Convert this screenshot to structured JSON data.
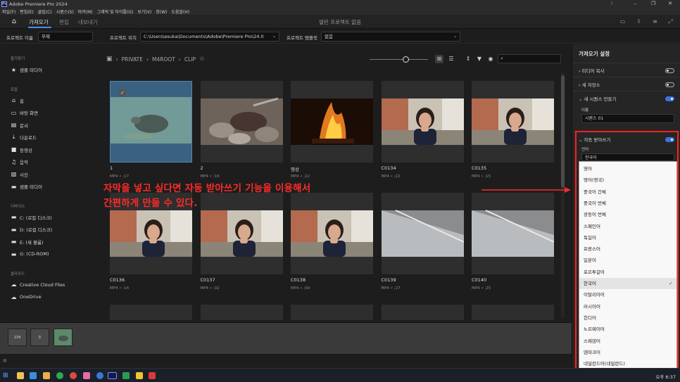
{
  "window": {
    "title": "Adobe Premiere Pro 2024",
    "app_icon_label": "Pr",
    "menus": [
      "파일(F)",
      "편집(E)",
      "클립(C)",
      "시퀀스(S)",
      "마커(M)",
      "그래픽 및 타이틀(G)",
      "보기(V)",
      "창(W)",
      "도움말(H)"
    ]
  },
  "header": {
    "tabs": [
      "가져오기",
      "편집",
      "내보내기"
    ],
    "active_tab": 0,
    "project_title": "열린 프로젝트 없음"
  },
  "project_row": {
    "name_label": "프로젝트 이름",
    "name_value": "무제",
    "location_label": "프로젝트 위치",
    "location_value": "C:\\Users\\esuka\\Documents\\Adobe\\Premiere Pro\\24.0",
    "template_label": "프로젝트 템플릿",
    "template_value": "없음"
  },
  "sidebar": {
    "sections": [
      {
        "heading": "즐겨찾기",
        "items": [
          {
            "label": "샘플 미디어",
            "icon": "star-icon"
          }
        ]
      },
      {
        "heading": "로컬",
        "items": [
          {
            "label": "홈",
            "icon": "home-icon"
          },
          {
            "label": "바탕 화면",
            "icon": "monitor-icon"
          },
          {
            "label": "문서",
            "icon": "document-icon"
          },
          {
            "label": "다운로드",
            "icon": "download-icon"
          },
          {
            "label": "동영상",
            "icon": "video-icon"
          },
          {
            "label": "음악",
            "icon": "music-icon"
          },
          {
            "label": "사진",
            "icon": "image-icon"
          },
          {
            "label": "샘플 미디어",
            "icon": "folder-icon"
          }
        ]
      },
      {
        "heading": "디바이스",
        "items": [
          {
            "label": "C: (로컬 디스크)",
            "icon": "folder-icon"
          },
          {
            "label": "D: (로컬 디스크)",
            "icon": "folder-icon"
          },
          {
            "label": "E: (새 볼륨)",
            "icon": "folder-icon"
          },
          {
            "label": "G: (CD-ROM)",
            "icon": "folder-icon"
          }
        ]
      },
      {
        "heading": "클라우드",
        "items": [
          {
            "label": "Creative Cloud Files",
            "icon": "cloud-icon"
          },
          {
            "label": "OneDrive",
            "icon": "cloud-icon"
          }
        ]
      }
    ]
  },
  "browser": {
    "breadcrumb": [
      "PRIVATE",
      "M4ROOT",
      "CLIP"
    ],
    "clips": [
      {
        "name": "1",
        "meta": "MP4 • ;17",
        "kind": "turtle",
        "selected": true
      },
      {
        "name": "2",
        "meta": "MP4 • ;16",
        "kind": "rocks",
        "selected": false
      },
      {
        "name": "영상",
        "meta": "MP4 • ;22",
        "kind": "fire",
        "selected": false
      },
      {
        "name": "C0134",
        "meta": "MP4 • ;22",
        "kind": "girl",
        "selected": false
      },
      {
        "name": "C0135",
        "meta": "MP4 • ;15",
        "kind": "girl",
        "selected": false
      },
      {
        "name": "C0136",
        "meta": "MP4 • ;14",
        "kind": "girl",
        "selected": false
      },
      {
        "name": "C0137",
        "meta": "MP4 • ;02",
        "kind": "girl",
        "selected": false
      },
      {
        "name": "C0138",
        "meta": "MP4 • ;09",
        "kind": "girl",
        "selected": false
      },
      {
        "name": "C0139",
        "meta": "MP4 • ;27",
        "kind": "grey",
        "selected": false
      },
      {
        "name": "C0140",
        "meta": "MP4 • ;25",
        "kind": "grey",
        "selected": false
      }
    ],
    "annotation": [
      "자막을 넣고 싶다면 자동 받아쓰기 기능을 이용해서",
      "간편하게 만들 수 있다."
    ]
  },
  "import_settings": {
    "title": "가져오기 설정",
    "media_copy": "미디어 복사",
    "new_bin": "새 저장소",
    "create_sequence": "새 시퀀스 만들기",
    "name_label": "이름",
    "sequence_name": "시퀀스 01",
    "auto_transcribe": "자동 받아쓰기",
    "language_label": "언어",
    "language_value": "한국어",
    "languages": [
      "영어",
      "영어(영국)",
      "중국어 간체",
      "중국어 번체",
      "광동어 번체",
      "스페인어",
      "독일어",
      "프랑스어",
      "일본어",
      "포르투갈어",
      "한국어",
      "이탈리아어",
      "러시아어",
      "힌디어",
      "노르웨이어",
      "스웨덴어",
      "덴마크어",
      "네덜란드어(네덜란드)"
    ],
    "selected_language": "한국어"
  },
  "bins": [
    {
      "label": "134"
    },
    {
      "label": "0"
    }
  ],
  "taskbar": {
    "time": "오후 6:37"
  }
}
